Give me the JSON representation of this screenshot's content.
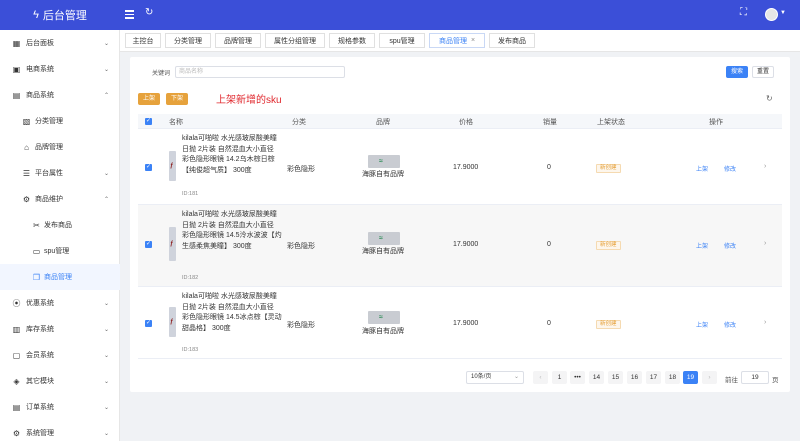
{
  "header": {
    "title": "后台管理",
    "icons": [
      "bolt-icon",
      "menu-icon",
      "refresh-icon",
      "fullscreen-icon",
      "avatar",
      "chevron-down-icon"
    ]
  },
  "sidebar": {
    "items": [
      {
        "label": "后台面板",
        "icon": "dashboard-icon",
        "caret": "⌄"
      },
      {
        "label": "电商系统",
        "icon": "shop-icon",
        "caret": "⌄"
      },
      {
        "label": "商品系统",
        "icon": "goods-icon",
        "caret": "⌃"
      },
      {
        "label": "分类管理",
        "icon": "category-icon",
        "caret": ""
      },
      {
        "label": "品牌管理",
        "icon": "brand-icon",
        "caret": ""
      },
      {
        "label": "平台属性",
        "icon": "attribute-icon",
        "caret": "⌄"
      },
      {
        "label": "商品维护",
        "icon": "maintain-icon",
        "caret": "⌃"
      },
      {
        "label": "发布商品",
        "icon": "publish-icon",
        "caret": ""
      },
      {
        "label": "spu管理",
        "icon": "spu-icon",
        "caret": ""
      },
      {
        "label": "商品管理",
        "icon": "cube-icon",
        "caret": ""
      },
      {
        "label": "优惠系统",
        "icon": "coupon-icon",
        "caret": "⌄"
      },
      {
        "label": "库存系统",
        "icon": "warehouse-icon",
        "caret": "⌄"
      },
      {
        "label": "会员系统",
        "icon": "member-icon",
        "caret": "⌄"
      },
      {
        "label": "其它模块",
        "icon": "module-icon",
        "caret": "⌄"
      },
      {
        "label": "订单系统",
        "icon": "order-icon",
        "caret": "⌄"
      },
      {
        "label": "系统管理",
        "icon": "settings-icon",
        "caret": "⌄"
      }
    ]
  },
  "tabs": [
    {
      "label": "主控台"
    },
    {
      "label": "分类管理"
    },
    {
      "label": "品牌管理"
    },
    {
      "label": "属性分组管理"
    },
    {
      "label": "规格参数"
    },
    {
      "label": "spu管理"
    },
    {
      "label": "商品管理",
      "close": "×"
    },
    {
      "label": "发布商品"
    }
  ],
  "search": {
    "label": "关键词",
    "placeholder": "商品名称",
    "search_button": "搜索",
    "reset_button": "重置"
  },
  "actions": {
    "up_button": "上架",
    "down_button": "下架",
    "annotation": "上架新增的sku"
  },
  "table": {
    "headers": [
      "名称",
      "分类",
      "品牌",
      "价格",
      "销量",
      "上架状态",
      "操作"
    ],
    "rows": [
      {
        "name": "kilala可啪啦 水光感玻尿酸美瞳日抛 2片装 自然混血大小直径 彩色隐形眼镜 14.2乌木棕日棕【纯俊超气质】 300度",
        "id": "ID:181",
        "category": "彩色隐形",
        "brand": "海豚自有品牌",
        "price": "17.9000",
        "sales": "0",
        "status": "新创建",
        "op_up": "上架",
        "op_edit": "修改",
        "arrow": "›"
      },
      {
        "name": "kilala可啪啦 水光感玻尿酸美瞳日抛 2片装 自然混血大小直径 彩色隐形眼镜 14.5泠水波波【灼生感柔焦美瞳】 300度",
        "id": "ID:182",
        "category": "彩色隐形",
        "brand": "海豚自有品牌",
        "price": "17.9000",
        "sales": "0",
        "status": "新创建",
        "op_up": "上架",
        "op_edit": "修改",
        "arrow": "›"
      },
      {
        "name": "kilala可啪啦 水光感玻尿酸美瞳日抛 2片装 自然混血大小直径 彩色隐形眼镜 14.5冰点棕【灵动甜晶格】 300度",
        "id": "ID:183",
        "category": "彩色隐形",
        "brand": "海豚自有品牌",
        "price": "17.9000",
        "sales": "0",
        "status": "新创建",
        "op_up": "上架",
        "op_edit": "修改",
        "arrow": "›"
      }
    ]
  },
  "pagination": {
    "page_size": "10条/页",
    "prev": "‹",
    "next": "›",
    "pages": [
      "1",
      "•••",
      "14",
      "15",
      "16",
      "17",
      "18",
      "19"
    ],
    "current": "19",
    "goto_label": "前往",
    "goto_value": "19",
    "page_suffix": "页"
  },
  "colors": {
    "header_bg": "#3b4fd8",
    "primary": "#3b82f6",
    "warning": "#e6a23c",
    "annotation": "#e0282e"
  }
}
